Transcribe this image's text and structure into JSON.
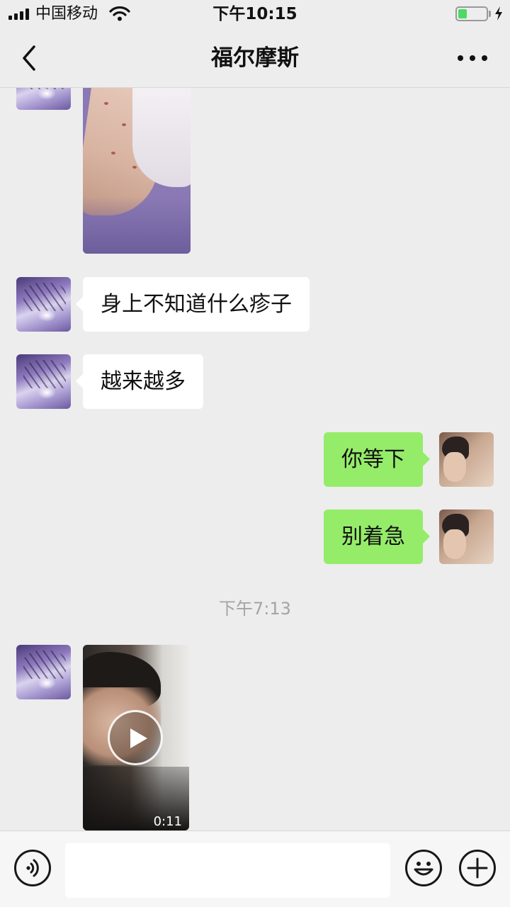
{
  "status_bar": {
    "carrier": "中国移动",
    "time": "下午10:15",
    "battery_level": 0.32,
    "icons": [
      "signal-icon",
      "wifi-icon",
      "battery-icon",
      "charging-icon"
    ]
  },
  "nav": {
    "title": "福尔摩斯",
    "back_icon": "chevron-left-icon",
    "more_icon": "more-dots-icon"
  },
  "messages": [
    {
      "type": "image",
      "sender": "peer"
    },
    {
      "type": "text",
      "sender": "peer",
      "text": "身上不知道什么疹子"
    },
    {
      "type": "text",
      "sender": "peer",
      "text": "越来越多"
    },
    {
      "type": "text",
      "sender": "self",
      "text": "你等下"
    },
    {
      "type": "text",
      "sender": "self",
      "text": "别着急"
    },
    {
      "type": "timestamp",
      "text": "下午7:13"
    },
    {
      "type": "video",
      "sender": "peer",
      "duration": "0:11"
    }
  ],
  "input_bar": {
    "value": "",
    "icons": [
      "voice-icon",
      "emoji-icon",
      "plus-icon"
    ]
  },
  "colors": {
    "background": "#ededed",
    "outgoing_bubble": "#95ec69",
    "incoming_bubble": "#ffffff",
    "timestamp_text": "#a4a4a4",
    "battery_fill": "#4cd964"
  }
}
